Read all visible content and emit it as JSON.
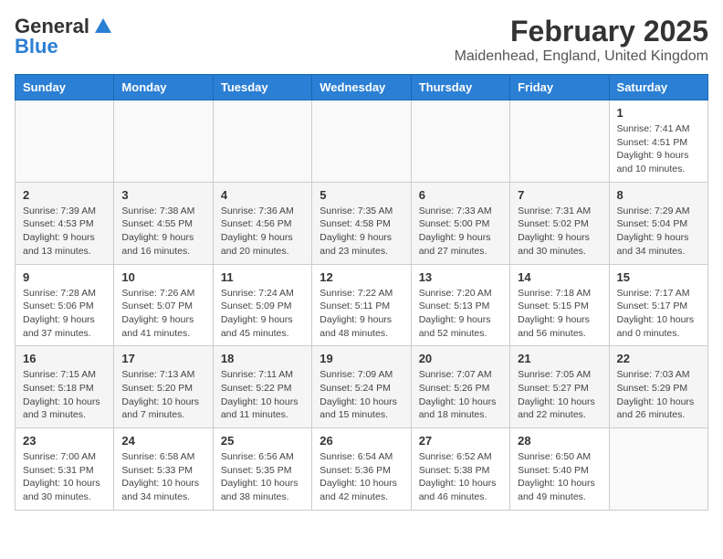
{
  "header": {
    "logo_general": "General",
    "logo_blue": "Blue",
    "month_year": "February 2025",
    "location": "Maidenhead, England, United Kingdom"
  },
  "weekdays": [
    "Sunday",
    "Monday",
    "Tuesday",
    "Wednesday",
    "Thursday",
    "Friday",
    "Saturday"
  ],
  "weeks": [
    [
      {
        "day": "",
        "info": ""
      },
      {
        "day": "",
        "info": ""
      },
      {
        "day": "",
        "info": ""
      },
      {
        "day": "",
        "info": ""
      },
      {
        "day": "",
        "info": ""
      },
      {
        "day": "",
        "info": ""
      },
      {
        "day": "1",
        "info": "Sunrise: 7:41 AM\nSunset: 4:51 PM\nDaylight: 9 hours\nand 10 minutes."
      }
    ],
    [
      {
        "day": "2",
        "info": "Sunrise: 7:39 AM\nSunset: 4:53 PM\nDaylight: 9 hours\nand 13 minutes."
      },
      {
        "day": "3",
        "info": "Sunrise: 7:38 AM\nSunset: 4:55 PM\nDaylight: 9 hours\nand 16 minutes."
      },
      {
        "day": "4",
        "info": "Sunrise: 7:36 AM\nSunset: 4:56 PM\nDaylight: 9 hours\nand 20 minutes."
      },
      {
        "day": "5",
        "info": "Sunrise: 7:35 AM\nSunset: 4:58 PM\nDaylight: 9 hours\nand 23 minutes."
      },
      {
        "day": "6",
        "info": "Sunrise: 7:33 AM\nSunset: 5:00 PM\nDaylight: 9 hours\nand 27 minutes."
      },
      {
        "day": "7",
        "info": "Sunrise: 7:31 AM\nSunset: 5:02 PM\nDaylight: 9 hours\nand 30 minutes."
      },
      {
        "day": "8",
        "info": "Sunrise: 7:29 AM\nSunset: 5:04 PM\nDaylight: 9 hours\nand 34 minutes."
      }
    ],
    [
      {
        "day": "9",
        "info": "Sunrise: 7:28 AM\nSunset: 5:06 PM\nDaylight: 9 hours\nand 37 minutes."
      },
      {
        "day": "10",
        "info": "Sunrise: 7:26 AM\nSunset: 5:07 PM\nDaylight: 9 hours\nand 41 minutes."
      },
      {
        "day": "11",
        "info": "Sunrise: 7:24 AM\nSunset: 5:09 PM\nDaylight: 9 hours\nand 45 minutes."
      },
      {
        "day": "12",
        "info": "Sunrise: 7:22 AM\nSunset: 5:11 PM\nDaylight: 9 hours\nand 48 minutes."
      },
      {
        "day": "13",
        "info": "Sunrise: 7:20 AM\nSunset: 5:13 PM\nDaylight: 9 hours\nand 52 minutes."
      },
      {
        "day": "14",
        "info": "Sunrise: 7:18 AM\nSunset: 5:15 PM\nDaylight: 9 hours\nand 56 minutes."
      },
      {
        "day": "15",
        "info": "Sunrise: 7:17 AM\nSunset: 5:17 PM\nDaylight: 10 hours\nand 0 minutes."
      }
    ],
    [
      {
        "day": "16",
        "info": "Sunrise: 7:15 AM\nSunset: 5:18 PM\nDaylight: 10 hours\nand 3 minutes."
      },
      {
        "day": "17",
        "info": "Sunrise: 7:13 AM\nSunset: 5:20 PM\nDaylight: 10 hours\nand 7 minutes."
      },
      {
        "day": "18",
        "info": "Sunrise: 7:11 AM\nSunset: 5:22 PM\nDaylight: 10 hours\nand 11 minutes."
      },
      {
        "day": "19",
        "info": "Sunrise: 7:09 AM\nSunset: 5:24 PM\nDaylight: 10 hours\nand 15 minutes."
      },
      {
        "day": "20",
        "info": "Sunrise: 7:07 AM\nSunset: 5:26 PM\nDaylight: 10 hours\nand 18 minutes."
      },
      {
        "day": "21",
        "info": "Sunrise: 7:05 AM\nSunset: 5:27 PM\nDaylight: 10 hours\nand 22 minutes."
      },
      {
        "day": "22",
        "info": "Sunrise: 7:03 AM\nSunset: 5:29 PM\nDaylight: 10 hours\nand 26 minutes."
      }
    ],
    [
      {
        "day": "23",
        "info": "Sunrise: 7:00 AM\nSunset: 5:31 PM\nDaylight: 10 hours\nand 30 minutes."
      },
      {
        "day": "24",
        "info": "Sunrise: 6:58 AM\nSunset: 5:33 PM\nDaylight: 10 hours\nand 34 minutes."
      },
      {
        "day": "25",
        "info": "Sunrise: 6:56 AM\nSunset: 5:35 PM\nDaylight: 10 hours\nand 38 minutes."
      },
      {
        "day": "26",
        "info": "Sunrise: 6:54 AM\nSunset: 5:36 PM\nDaylight: 10 hours\nand 42 minutes."
      },
      {
        "day": "27",
        "info": "Sunrise: 6:52 AM\nSunset: 5:38 PM\nDaylight: 10 hours\nand 46 minutes."
      },
      {
        "day": "28",
        "info": "Sunrise: 6:50 AM\nSunset: 5:40 PM\nDaylight: 10 hours\nand 49 minutes."
      },
      {
        "day": "",
        "info": ""
      }
    ]
  ]
}
